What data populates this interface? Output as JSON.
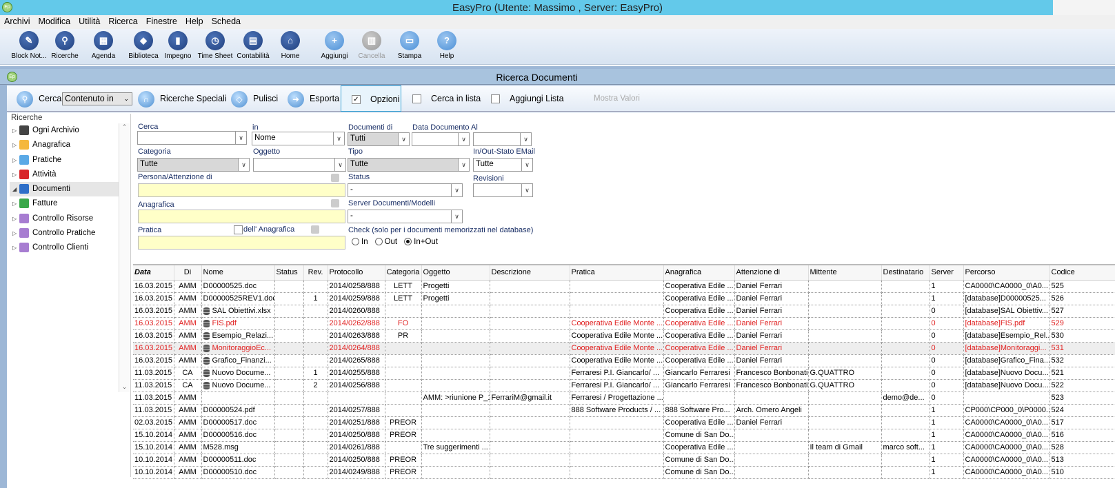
{
  "window": {
    "title": "EasyPro (Utente: Massimo , Server: EasyPro)",
    "logo": "Ep"
  },
  "menu": [
    "Archivi",
    "Modifica",
    "Utilità",
    "Ricerca",
    "Finestre",
    "Help",
    "Scheda"
  ],
  "toolbar": [
    {
      "label": "Block Not...",
      "icon": "notepad-icon"
    },
    {
      "label": "Ricerche",
      "icon": "search-icon"
    },
    {
      "label": "Agenda",
      "icon": "calendar-icon"
    },
    {
      "label": "Biblioteca",
      "icon": "box-icon"
    },
    {
      "label": "Impegno",
      "icon": "chart-icon"
    },
    {
      "label": "Time Sheet",
      "icon": "clock-icon"
    },
    {
      "label": "Contabilità",
      "icon": "calculator-icon"
    },
    {
      "label": "Home",
      "icon": "home-icon"
    },
    {
      "label": "Aggiungi",
      "icon": "plus-icon"
    },
    {
      "label": "Cancella",
      "icon": "trash-icon",
      "disabled": true
    },
    {
      "label": "Stampa",
      "icon": "printer-icon"
    },
    {
      "label": "Help",
      "icon": "help-icon"
    }
  ],
  "subwindow": {
    "title": "Ricerca Documenti"
  },
  "search_toolbar": {
    "cerca": "Cerca",
    "mode": "Contenuto in",
    "ricerche_speciali": "Ricerche Speciali",
    "pulisci": "Pulisci",
    "esporta": "Esporta",
    "opzioni": "Opzioni",
    "opzioni_checked": true,
    "cerca_in_lista": "Cerca in lista",
    "aggiungi_lista": "Aggiungi Lista",
    "mostra_valori": "Mostra Valori"
  },
  "sidebar": {
    "header": "Ricerche",
    "items": [
      {
        "label": "Ogni Archivio",
        "color": "#444444"
      },
      {
        "label": "Anagrafica",
        "color": "#f5b83d"
      },
      {
        "label": "Pratiche",
        "color": "#5aa9e6"
      },
      {
        "label": "Attività",
        "color": "#d8262a"
      },
      {
        "label": "Documenti",
        "color": "#2f6fc8",
        "selected": true
      },
      {
        "label": "Fatture",
        "color": "#3aa84a"
      },
      {
        "label": "Controllo Risorse",
        "color": "#a77dd1"
      },
      {
        "label": "Controllo Pratiche",
        "color": "#a77dd1"
      },
      {
        "label": "Controllo Clienti",
        "color": "#a77dd1"
      }
    ]
  },
  "form": {
    "cerca": {
      "label": "Cerca",
      "value": ""
    },
    "in": {
      "label": "in",
      "value": "Nome"
    },
    "documenti_di": {
      "label": "Documenti di",
      "value": "Tutti"
    },
    "data_documento": {
      "label": "Data Documento",
      "value": ""
    },
    "al": {
      "label": "Al",
      "value": ""
    },
    "categoria": {
      "label": "Categoria",
      "value": "Tutte"
    },
    "oggetto": {
      "label": "Oggetto",
      "value": ""
    },
    "tipo": {
      "label": "Tipo",
      "value": "Tutte"
    },
    "inout": {
      "label": "In/Out-Stato EMail",
      "value": "Tutte"
    },
    "persona": {
      "label": "Persona/Attenzione di",
      "value": ""
    },
    "status": {
      "label": "Status",
      "value": "-"
    },
    "revisioni": {
      "label": "Revisioni",
      "value": ""
    },
    "anagrafica": {
      "label": "Anagrafica",
      "value": ""
    },
    "server": {
      "label": "Server Documenti/Modelli",
      "value": "-"
    },
    "pratica": {
      "label": "Pratica",
      "value": ""
    },
    "dell_anagrafica": "dell' Anagrafica",
    "check": {
      "label": "Check (solo per i documenti memorizzati nel database)",
      "options": [
        "In",
        "Out",
        "In+Out"
      ],
      "selected": "In+Out"
    }
  },
  "grid": {
    "columns": [
      "Data",
      "Di",
      "Nome",
      "Status",
      "Rev.",
      "Protocollo",
      "Categoria",
      "Oggetto",
      "Descrizione",
      "Pratica",
      "Anagrafica",
      "Attenzione di",
      "Mittente",
      "Destinatario",
      "Server",
      "Percorso",
      "Codice"
    ],
    "rows": [
      {
        "cells": [
          "16.03.2015",
          "AMM",
          "D00000525.doc",
          "",
          "",
          "2014/0258/888",
          "LETT",
          "Progetti",
          "",
          "",
          "Cooperativa Edile ...",
          "Daniel Ferrari",
          "",
          "",
          "1",
          "CA0000\\CA0000_0\\A0...",
          "525"
        ]
      },
      {
        "cells": [
          "16.03.2015",
          "AMM",
          "D00000525REV1.doc",
          "",
          "1",
          "2014/0259/888",
          "LETT",
          "Progetti",
          "",
          "",
          "Cooperativa Edile ...",
          "Daniel Ferrari",
          "",
          "",
          "1",
          "[database]D00000525...",
          "526"
        ]
      },
      {
        "db": true,
        "cells": [
          "16.03.2015",
          "AMM",
          "SAL Obiettivi.xlsx",
          "",
          "",
          "2014/0260/888",
          "",
          "",
          "",
          "",
          "Cooperativa Edile ...",
          "Daniel Ferrari",
          "",
          "",
          "0",
          "[database]SAL Obiettiv...",
          "527"
        ]
      },
      {
        "db": true,
        "red": true,
        "cells": [
          "16.03.2015",
          "AMM",
          "FIS.pdf",
          "",
          "",
          "2014/0262/888",
          "FO",
          "",
          "",
          "Cooperativa Edile Monte ...",
          "Cooperativa Edile ...",
          "Daniel Ferrari",
          "",
          "",
          "0",
          "[database]FIS.pdf",
          "529"
        ]
      },
      {
        "db": true,
        "cells": [
          "16.03.2015",
          "AMM",
          "Esempio_Relazi...",
          "",
          "",
          "2014/0263/888",
          "PR",
          "",
          "",
          "Cooperativa Edile Monte ...",
          "Cooperativa Edile ...",
          "Daniel Ferrari",
          "",
          "",
          "0",
          "[database]Esempio_Rel...",
          "530"
        ]
      },
      {
        "db": true,
        "red": true,
        "highlight": true,
        "cells": [
          "16.03.2015",
          "AMM",
          "MonitoraggioEc...",
          "",
          "",
          "2014/0264/888",
          "",
          "",
          "",
          "Cooperativa Edile Monte ...",
          "Cooperativa Edile ...",
          "Daniel Ferrari",
          "",
          "",
          "0",
          "[database]Monitoraggi...",
          "531"
        ]
      },
      {
        "db": true,
        "cells": [
          "16.03.2015",
          "AMM",
          "Grafico_Finanzi...",
          "",
          "",
          "2014/0265/888",
          "",
          "",
          "",
          "Cooperativa Edile Monte ...",
          "Cooperativa Edile ...",
          "Daniel Ferrari",
          "",
          "",
          "0",
          "[database]Grafico_Fina...",
          "532"
        ]
      },
      {
        "db": true,
        "cells": [
          "11.03.2015",
          "CA",
          "Nuovo Docume...",
          "",
          "1",
          "2014/0255/888",
          "",
          "",
          "",
          "Ferraresi P.I. Giancarlo/ ...",
          "Giancarlo Ferraresi",
          "Francesco Bonbonati",
          "G.QUATTRO",
          "",
          "0",
          "[database]Nuovo Docu...",
          "521"
        ]
      },
      {
        "db": true,
        "cells": [
          "11.03.2015",
          "CA",
          "Nuovo Docume...",
          "",
          "2",
          "2014/0256/888",
          "",
          "",
          "",
          "Ferraresi P.I. Giancarlo/ ...",
          "Giancarlo Ferraresi",
          "Francesco Bonbonati",
          "G.QUATTRO",
          "",
          "0",
          "[database]Nuovo Docu...",
          "522"
        ]
      },
      {
        "cells": [
          "11.03.2015",
          "AMM",
          "",
          "",
          "",
          "",
          "",
          "AMM: >riunione P_1",
          "FerrariM@gmail.it",
          "Ferraresi / Progettazione ...",
          "",
          "",
          "",
          "demo@de...",
          "0",
          "",
          "523"
        ]
      },
      {
        "cells": [
          "11.03.2015",
          "AMM",
          "D00000524.pdf",
          "",
          "",
          "2014/0257/888",
          "",
          "",
          "",
          "888 Software Products  / ...",
          "888 Software Pro...",
          "Arch. Omero Angeli",
          "",
          "",
          "1",
          "CP000\\CP000_0\\P0000...",
          "524"
        ]
      },
      {
        "cells": [
          "02.03.2015",
          "AMM",
          "D00000517.doc",
          "",
          "",
          "2014/0251/888",
          "PREOR",
          "",
          "",
          "",
          "Cooperativa Edile ...",
          "Daniel Ferrari",
          "",
          "",
          "1",
          "CA0000\\CA0000_0\\A0...",
          "517"
        ]
      },
      {
        "cells": [
          "15.10.2014",
          "AMM",
          "D00000516.doc",
          "",
          "",
          "2014/0250/888",
          "PREOR",
          "",
          "",
          "",
          "Comune di San Do...",
          "",
          "",
          "",
          "1",
          "CA0000\\CA0000_0\\A0...",
          "516"
        ]
      },
      {
        "cells": [
          "15.10.2014",
          "AMM",
          "M528.msg",
          "",
          "",
          "2014/0261/888",
          "",
          "Tre suggerimenti ...",
          "",
          "",
          "Cooperativa Edile ...",
          "",
          "Il team di Gmail",
          "marco soft...",
          "1",
          "CA0000\\CA0000_0\\A0...",
          "528"
        ]
      },
      {
        "cells": [
          "10.10.2014",
          "AMM",
          "D00000511.doc",
          "",
          "",
          "2014/0250/888",
          "PREOR",
          "",
          "",
          "",
          "Comune di San Do...",
          "",
          "",
          "",
          "1",
          "CA0000\\CA0000_0\\A0...",
          "513"
        ]
      },
      {
        "cells": [
          "10.10.2014",
          "AMM",
          "D00000510.doc",
          "",
          "",
          "2014/0249/888",
          "PREOR",
          "",
          "",
          "",
          "Comune di San Do...",
          "",
          "",
          "",
          "1",
          "CA0000\\CA0000_0\\A0...",
          "510"
        ]
      }
    ]
  }
}
